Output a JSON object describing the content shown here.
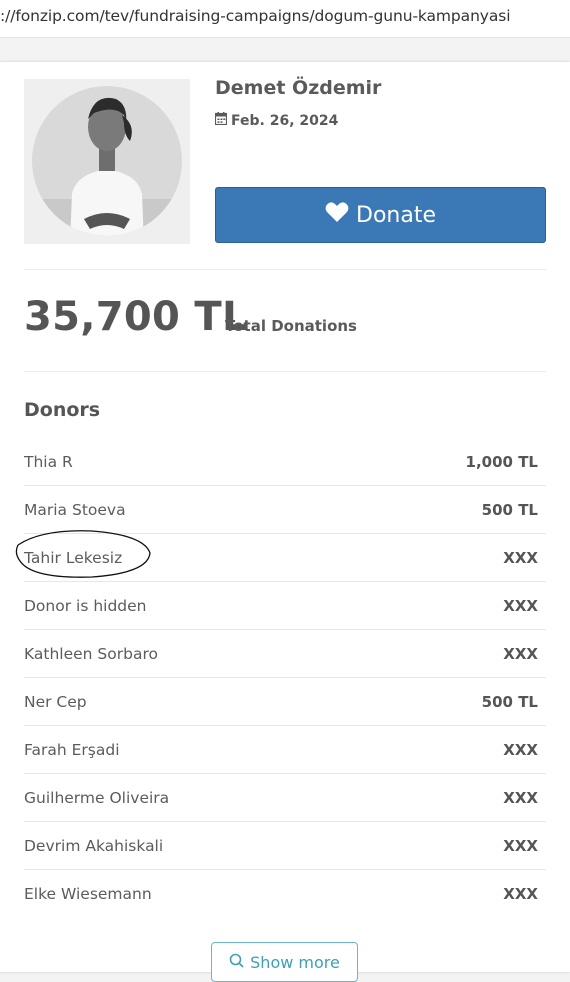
{
  "browser": {
    "url": "://fonzip.com/tev/fundraising-campaigns/dogum-gunu-kampanyasi"
  },
  "campaign": {
    "owner_name": "Demet Özdemir",
    "date": "Feb. 26, 2024",
    "donate_label": "Donate",
    "total_amount": "35,700 TL",
    "total_label": "Total Donations",
    "accent_color": "#3a78b6"
  },
  "donors": {
    "heading": "Donors",
    "items": [
      {
        "name": "Thia R",
        "amount": "1,000 TL"
      },
      {
        "name": "Maria Stoeva",
        "amount": "500 TL"
      },
      {
        "name": "Tahir Lekesiz",
        "amount": "XXX"
      },
      {
        "name": "Donor is hidden",
        "amount": "XXX"
      },
      {
        "name": "Kathleen Sorbaro",
        "amount": "XXX"
      },
      {
        "name": "Ner Cep",
        "amount": "500 TL"
      },
      {
        "name": "Farah Erşadi",
        "amount": "XXX"
      },
      {
        "name": "Guilherme Oliveira",
        "amount": "XXX"
      },
      {
        "name": "Devrim Akahiskali",
        "amount": "XXX"
      },
      {
        "name": "Elke Wiesemann",
        "amount": "XXX"
      }
    ],
    "show_more_label": "Show more"
  },
  "icons": {
    "date": "calendar-icon",
    "donate": "heart-icon",
    "show_more": "search-icon"
  }
}
